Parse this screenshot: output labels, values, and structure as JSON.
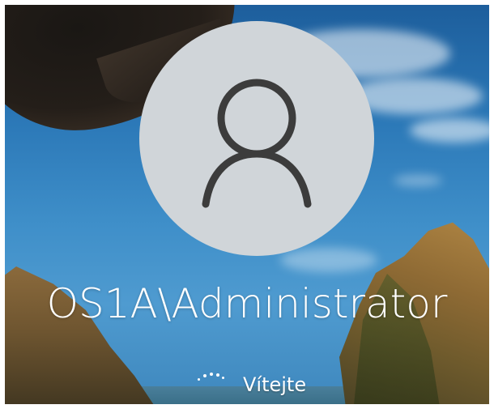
{
  "login": {
    "username": "OS1A\\Administrator",
    "status_text": "Vítejte"
  },
  "icons": {
    "avatar": "user-silhouette-icon",
    "spinner": "loading-dots-spinner"
  },
  "colors": {
    "avatar_background": "#d0d5d9",
    "avatar_glyph": "#3c3c3c",
    "text": "#ffffff"
  }
}
